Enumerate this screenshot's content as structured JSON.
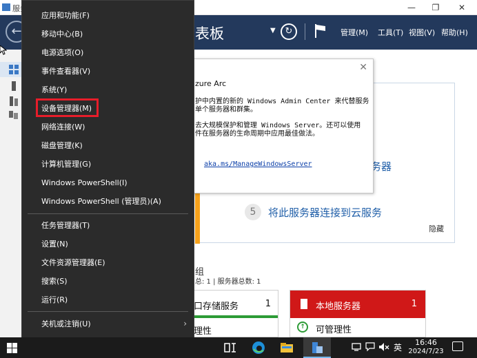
{
  "window": {
    "title": "服务",
    "minimize_glyph": "—",
    "restore_glyph": "❐",
    "close_glyph": "✕"
  },
  "header": {
    "dashboard_title": "表板",
    "menus": [
      "管理(M)",
      "工具(T)",
      "视图(V)",
      "帮助(H)"
    ]
  },
  "azure_popup": {
    "title": "zure Arc",
    "lines": [
      "护中内置的新的 Windows Admin Center 来代替服务",
      "单个服务器和群集。",
      "去大规模保护和管理 Windows Server。还可以使用",
      "件在服务器的生命周期中应用最佳做法。"
    ],
    "link": "aka.ms/ManageWindowsServer"
  },
  "welcome": {
    "step4_label": "务器",
    "step5_number": "5",
    "step5_label": "将此服务器连接到云服务",
    "hide_label": "隐藏"
  },
  "roles": {
    "header": "组",
    "count_text": "总: 1 | 服务器总数: 1"
  },
  "tile_storage": {
    "label": "口存储服务",
    "count": "1",
    "sub": "理性",
    "accent": "#2c9b36"
  },
  "tile_local": {
    "label": "本地服务器",
    "count": "1",
    "sub": "可管理性",
    "accent": "#d01818"
  },
  "context_menu": {
    "group1": [
      "应用和功能(F)",
      "移动中心(B)",
      "电源选项(O)",
      "事件查看器(V)",
      "系统(Y)",
      "设备管理器(M)",
      "网络连接(W)",
      "磁盘管理(K)",
      "计算机管理(G)",
      "Windows PowerShell(I)",
      "Windows PowerShell (管理员)(A)"
    ],
    "group2": [
      "任务管理器(T)",
      "设置(N)",
      "文件资源管理器(E)",
      "搜索(S)",
      "运行(R)"
    ],
    "group3": [
      "关机或注销(U)",
      "桌面(D)"
    ],
    "highlighted_item": "设备管理器(M)",
    "highlight_color": "#e81d2a"
  },
  "taskbar": {
    "ime_label": "英",
    "time": "16:46",
    "date": "2024/7/23"
  }
}
